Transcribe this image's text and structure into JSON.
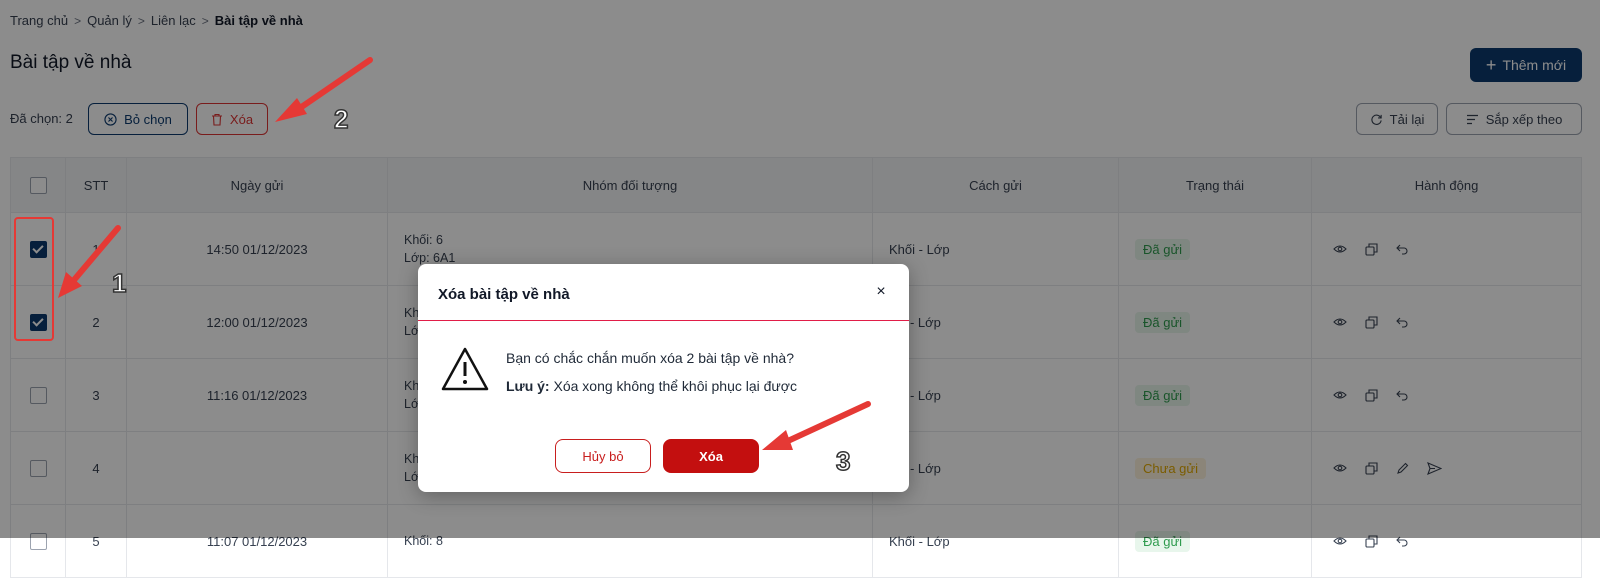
{
  "breadcrumb": {
    "items": [
      "Trang chủ",
      "Quản lý",
      "Liên lạc"
    ],
    "current": "Bài tập về nhà",
    "separator": ">"
  },
  "page": {
    "title": "Bài tập về nhà",
    "add_button": "Thêm mới"
  },
  "toolbar": {
    "selected_label": "Đã chọn: 2",
    "deselect_button": "Bỏ chọn",
    "delete_button": "Xóa",
    "reload_button": "Tải lại",
    "sort_button": "Sắp xếp theo"
  },
  "table": {
    "headers": [
      "STT",
      "Ngày gửi",
      "Nhóm đối tượng",
      "Cách gửi",
      "Trạng thái",
      "Hành động"
    ],
    "rows": [
      {
        "stt": "1",
        "date": "14:50 01/12/2023",
        "group1": "Khối: 6",
        "group2": "Lớp: 6A1",
        "method": "Khối - Lớp",
        "status": "Đã gửi",
        "checked": true
      },
      {
        "stt": "2",
        "date": "12:00 01/12/2023",
        "group1": "Kh",
        "group2": "Lớ",
        "method": "hối - Lớp",
        "status": "Đã gửi",
        "checked": true
      },
      {
        "stt": "3",
        "date": "11:16 01/12/2023",
        "group1": "Kh",
        "group2": "Lớ",
        "method": "hối - Lớp",
        "status": "Đã gửi",
        "checked": false
      },
      {
        "stt": "4",
        "date": "",
        "group1": "Kh",
        "group2": "Lớ",
        "method": "hối - Lớp",
        "status": "Chưa gửi",
        "checked": false
      },
      {
        "stt": "5",
        "date": "11:07 01/12/2023",
        "group1": "Khối: 8",
        "group2": "",
        "method": "Khối - Lớp",
        "status": "Đã gửi",
        "checked": false
      }
    ]
  },
  "modal": {
    "title": "Xóa bài tập về nhà",
    "close": "×",
    "message": "Bạn có chắc chắn muốn xóa 2 bài tập về nhà?",
    "note_label": "Lưu ý:",
    "note_text": "Xóa xong không thể khôi phục lại được",
    "cancel_button": "Hủy bỏ",
    "confirm_button": "Xóa"
  },
  "annotations": {
    "step1": "1",
    "step2": "2",
    "step3": "3"
  },
  "colors": {
    "primary": "#0b3a6e",
    "danger": "#c30f0f",
    "sent": "#2e9b4e",
    "draft": "#e0a800",
    "arrow": "#e53935"
  }
}
